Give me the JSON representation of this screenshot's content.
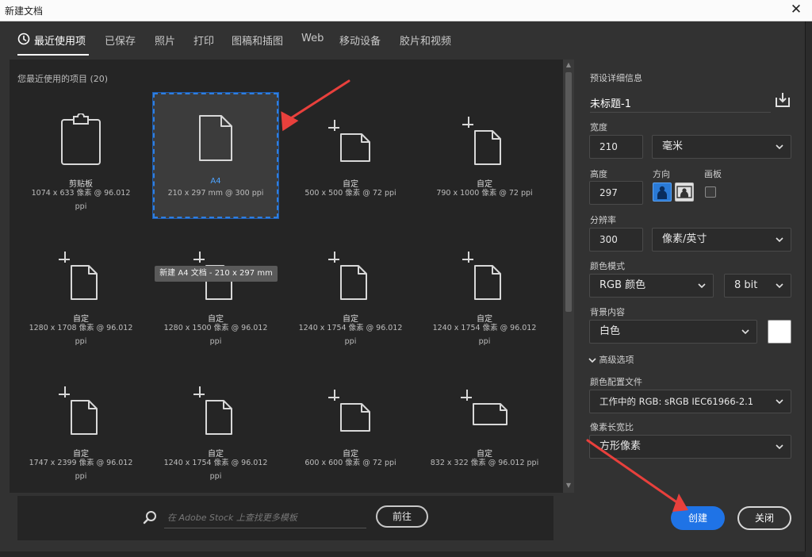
{
  "window": {
    "title": "新建文档",
    "close_glyph": "✕"
  },
  "tabs": [
    {
      "label": "最近使用项",
      "active": true,
      "icon": "clock-icon"
    },
    {
      "label": "已保存"
    },
    {
      "label": "照片"
    },
    {
      "label": "打印"
    },
    {
      "label": "图稿和插图"
    },
    {
      "label": "Web"
    },
    {
      "label": "移动设备"
    },
    {
      "label": "胶片和视频"
    }
  ],
  "recent": {
    "title": "您最近使用的项目 (20)",
    "presets": [
      {
        "name": "剪贴板",
        "desc": "1074 x 633 像素 @ 96.012",
        "desc2": "ppi",
        "icon": "clipboard-icon"
      },
      {
        "name": "A4",
        "desc": "210 x 297 mm @ 300 ppi",
        "desc2": "",
        "icon": "document-icon",
        "selected": true
      },
      {
        "name": "自定",
        "desc": "500 x 500 像素 @ 72 ppi",
        "desc2": "",
        "icon": "custom-square-icon"
      },
      {
        "name": "自定",
        "desc": "790 x 1000 像素 @ 72 ppi",
        "desc2": "",
        "icon": "custom-portrait-icon"
      },
      {
        "name": "自定",
        "desc": "1280 x 1708 像素 @ 96.012",
        "desc2": "ppi",
        "icon": "custom-portrait-icon"
      },
      {
        "name": "自定",
        "desc": "1280 x 1500 像素 @ 96.012",
        "desc2": "ppi",
        "icon": "custom-portrait-icon"
      },
      {
        "name": "自定",
        "desc": "1240 x 1754 像素 @ 96.012",
        "desc2": "ppi",
        "icon": "custom-portrait-icon"
      },
      {
        "name": "自定",
        "desc": "1240 x 1754 像素 @ 96.012",
        "desc2": "ppi",
        "icon": "custom-portrait-icon"
      },
      {
        "name": "自定",
        "desc": "1747 x 2399 像素 @ 96.012",
        "desc2": "ppi",
        "icon": "custom-portrait-icon"
      },
      {
        "name": "自定",
        "desc": "1240 x 1754 像素 @ 96.012",
        "desc2": "ppi",
        "icon": "custom-portrait-icon"
      },
      {
        "name": "自定",
        "desc": "600 x 600 像素 @ 72 ppi",
        "desc2": "",
        "icon": "custom-square-icon"
      },
      {
        "name": "自定",
        "desc": "832 x 322 像素 @ 96.012 ppi",
        "desc2": "",
        "icon": "custom-landscape-icon"
      }
    ],
    "tooltip": "新建 A4 文档 - 210 x 297 mm"
  },
  "stock": {
    "placeholder": "在 Adobe Stock 上查找更多模板",
    "goto_label": "前往"
  },
  "details": {
    "section_label": "预设详细信息",
    "doc_name": "未标题-1",
    "width_label": "宽度",
    "width_value": "210",
    "width_unit": "毫米",
    "height_label": "高度",
    "height_value": "297",
    "orientation_label": "方向",
    "artboard_label": "画板",
    "resolution_label": "分辨率",
    "resolution_value": "300",
    "resolution_unit": "像素/英寸",
    "color_mode_label": "颜色模式",
    "color_mode_value": "RGB 颜色",
    "bit_depth_value": "8 bit",
    "background_label": "背景内容",
    "background_value": "白色",
    "background_swatch": "#ffffff",
    "advanced_label": "高级选项",
    "profile_label": "颜色配置文件",
    "profile_value": "工作中的 RGB: sRGB IEC61966-2.1",
    "pixel_aspect_label": "像素长宽比",
    "pixel_aspect_value": "方形像素"
  },
  "buttons": {
    "create_label": "创建",
    "close_label": "关闭"
  },
  "colors": {
    "accent": "#1f73e6",
    "annotation_arrow": "#e8403c"
  }
}
